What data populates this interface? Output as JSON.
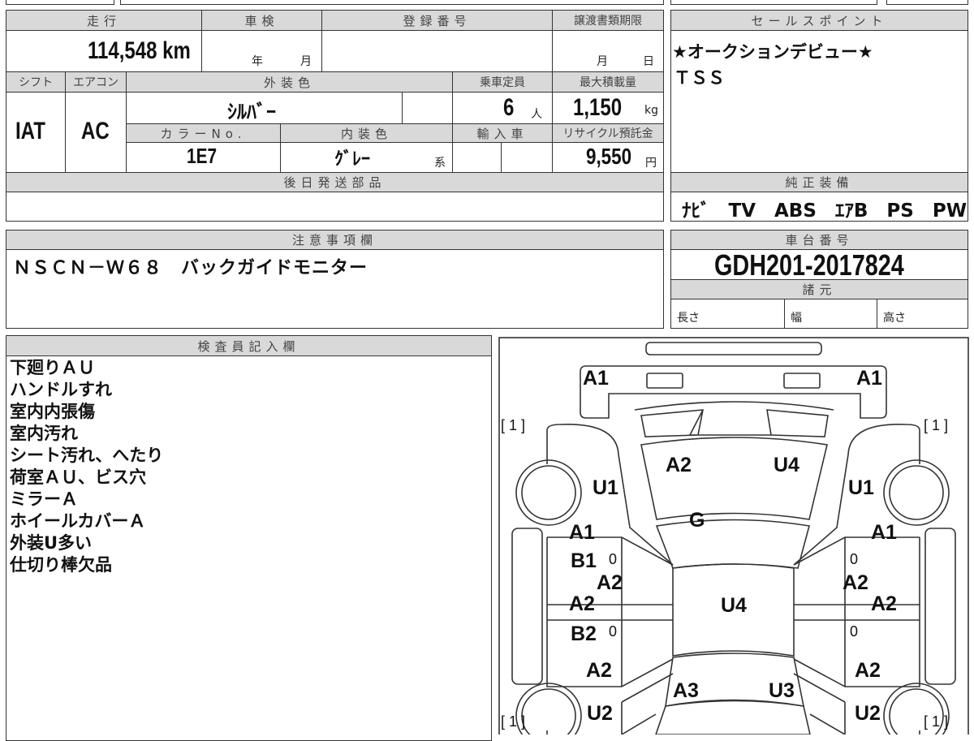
{
  "sheet": {
    "headers": {
      "mileage": "走行",
      "inspection": "車検",
      "registration_no": "登録番号",
      "transfer_deadline": "譲渡書類期限",
      "shift": "シフト",
      "aircon": "エアコン",
      "exterior_color": "外装色",
      "capacity": "乗車定員",
      "max_load": "最大積載量",
      "color_no": "カラーNo.",
      "interior_color": "内装色",
      "import": "輸入車",
      "recycle_fee": "リサイクル預託金",
      "later_parts": "後日発送部品",
      "sales_point": "セールスポイント",
      "equipment": "純正装備",
      "notes": "注意事項欄",
      "chassis_no": "車台番号",
      "specs": "諸元",
      "inspector": "検査員記入欄"
    },
    "mileage": "114,548 km",
    "inspection_year_unit": "年",
    "inspection_month_unit": "月",
    "deadline_month_unit": "月",
    "deadline_day_unit": "日",
    "shift": "IAT",
    "aircon": "AC",
    "exterior_color": "ｼﾙﾊﾞｰ",
    "capacity": "6",
    "capacity_unit": "人",
    "max_load": "1,150",
    "max_load_unit": "kg",
    "color_no": "1E7",
    "interior_color": "ｸﾞﾚｰ",
    "interior_suffix": "系",
    "recycle_fee": "9,550",
    "recycle_unit": "円",
    "sales_points": [
      "★オークションデビュー★",
      "ＴＳＳ"
    ],
    "equipment": "ﾅﾋﾞ　TV　ABS　ｴｱB　PS　PW",
    "notes": "ＮＳＣＮ－Ｗ６８　バックガイドモニター",
    "chassis_no": "GDH201-2017824",
    "specs": {
      "length": "長さ",
      "width": "幅",
      "height": "高さ"
    },
    "inspector_notes": [
      "下廻りＡＵ",
      "ハンドルすれ",
      "室内内張傷",
      "室内汚れ",
      "シート汚れ、へたり",
      "荷室ＡＵ、ビス穴",
      "ミラーＡ",
      "ホイールカバーＡ",
      "外装U多い",
      "仕切り棒欠品"
    ]
  },
  "diagram": {
    "front_bumper_left": "A1",
    "front_bumper_right": "A1",
    "tire_fl": "[ 1 ]",
    "tire_fr": "[ 1 ]",
    "tire_rl": "[ 1 ]",
    "tire_rr": "[ 1 ]",
    "hood_1": "A2",
    "hood_2": "U4",
    "fender_fl": "U1",
    "fender_fr": "U1",
    "windshield": "G",
    "door_fl": "A1",
    "door_fr": "A1",
    "pillar_l": "B1",
    "pillar_l_mark": "0",
    "pillar_r_mark": "0",
    "sill_l": "A2",
    "sill_r": "A2",
    "door_rl": "A2",
    "door_rr": "A2",
    "roof": "U4",
    "pillar_l2": "B2",
    "pillar_l2_mark": "0",
    "pillar_r2_mark": "0",
    "quarter_l": "A2",
    "quarter_r": "A2",
    "trunk_1": "A3",
    "trunk_2": "U3",
    "rear_l": "U2",
    "rear_r": "U2"
  }
}
